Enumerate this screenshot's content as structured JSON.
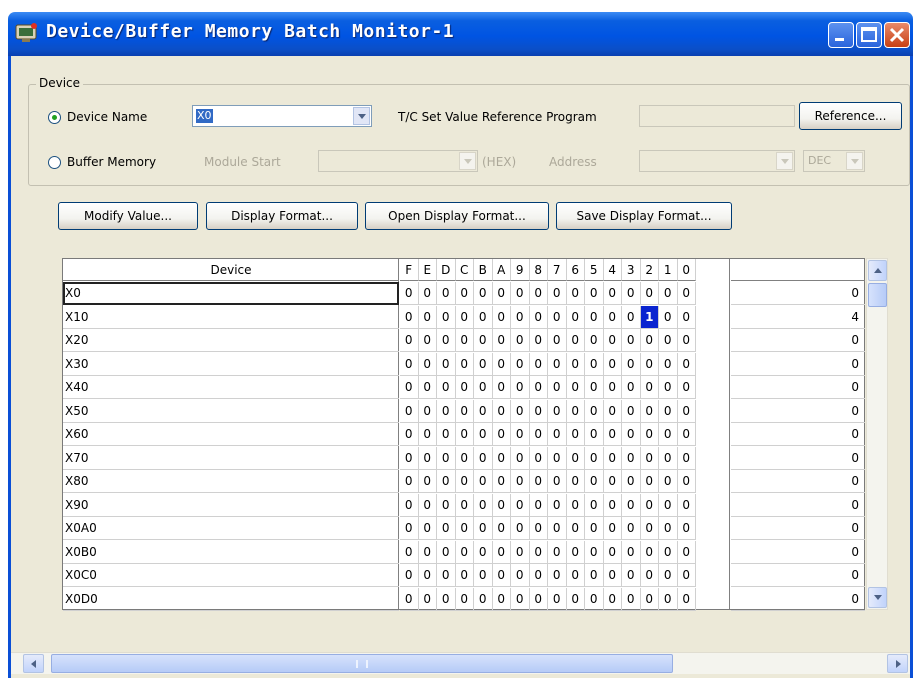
{
  "window": {
    "title": "Device/Buffer Memory Batch Monitor-1"
  },
  "device_group": {
    "legend": "Device",
    "device_name_label": "Device Name",
    "device_name_value": "X0",
    "tc_label": "T/C Set Value Reference Program",
    "tc_value": "",
    "reference_label": "Reference...",
    "buffer_memory_label": "Buffer Memory",
    "module_start_label": "Module Start",
    "module_start_value": "",
    "hex_label": "(HEX)",
    "address_label": "Address",
    "address_value": "",
    "format_value": "DEC",
    "selected_mode": "Device Name"
  },
  "toolbar": {
    "modify_value_label": "Modify Value...",
    "display_format_label": "Display Format...",
    "open_display_format_label": "Open Display Format...",
    "save_display_format_label": "Save Display Format..."
  },
  "grid": {
    "device_header": "Device",
    "bit_headers": [
      "F",
      "E",
      "D",
      "C",
      "B",
      "A",
      "9",
      "8",
      "7",
      "6",
      "5",
      "4",
      "3",
      "2",
      "1",
      "0"
    ],
    "value_header": "",
    "rows": [
      {
        "device": "X0",
        "bits": [
          "0",
          "0",
          "0",
          "0",
          "0",
          "0",
          "0",
          "0",
          "0",
          "0",
          "0",
          "0",
          "0",
          "0",
          "0",
          "0"
        ],
        "value": "0"
      },
      {
        "device": "X10",
        "bits": [
          "0",
          "0",
          "0",
          "0",
          "0",
          "0",
          "0",
          "0",
          "0",
          "0",
          "0",
          "0",
          "0",
          "1",
          "0",
          "0"
        ],
        "value": "4"
      },
      {
        "device": "X20",
        "bits": [
          "0",
          "0",
          "0",
          "0",
          "0",
          "0",
          "0",
          "0",
          "0",
          "0",
          "0",
          "0",
          "0",
          "0",
          "0",
          "0"
        ],
        "value": "0"
      },
      {
        "device": "X30",
        "bits": [
          "0",
          "0",
          "0",
          "0",
          "0",
          "0",
          "0",
          "0",
          "0",
          "0",
          "0",
          "0",
          "0",
          "0",
          "0",
          "0"
        ],
        "value": "0"
      },
      {
        "device": "X40",
        "bits": [
          "0",
          "0",
          "0",
          "0",
          "0",
          "0",
          "0",
          "0",
          "0",
          "0",
          "0",
          "0",
          "0",
          "0",
          "0",
          "0"
        ],
        "value": "0"
      },
      {
        "device": "X50",
        "bits": [
          "0",
          "0",
          "0",
          "0",
          "0",
          "0",
          "0",
          "0",
          "0",
          "0",
          "0",
          "0",
          "0",
          "0",
          "0",
          "0"
        ],
        "value": "0"
      },
      {
        "device": "X60",
        "bits": [
          "0",
          "0",
          "0",
          "0",
          "0",
          "0",
          "0",
          "0",
          "0",
          "0",
          "0",
          "0",
          "0",
          "0",
          "0",
          "0"
        ],
        "value": "0"
      },
      {
        "device": "X70",
        "bits": [
          "0",
          "0",
          "0",
          "0",
          "0",
          "0",
          "0",
          "0",
          "0",
          "0",
          "0",
          "0",
          "0",
          "0",
          "0",
          "0"
        ],
        "value": "0"
      },
      {
        "device": "X80",
        "bits": [
          "0",
          "0",
          "0",
          "0",
          "0",
          "0",
          "0",
          "0",
          "0",
          "0",
          "0",
          "0",
          "0",
          "0",
          "0",
          "0"
        ],
        "value": "0"
      },
      {
        "device": "X90",
        "bits": [
          "0",
          "0",
          "0",
          "0",
          "0",
          "0",
          "0",
          "0",
          "0",
          "0",
          "0",
          "0",
          "0",
          "0",
          "0",
          "0"
        ],
        "value": "0"
      },
      {
        "device": "X0A0",
        "bits": [
          "0",
          "0",
          "0",
          "0",
          "0",
          "0",
          "0",
          "0",
          "0",
          "0",
          "0",
          "0",
          "0",
          "0",
          "0",
          "0"
        ],
        "value": "0"
      },
      {
        "device": "X0B0",
        "bits": [
          "0",
          "0",
          "0",
          "0",
          "0",
          "0",
          "0",
          "0",
          "0",
          "0",
          "0",
          "0",
          "0",
          "0",
          "0",
          "0"
        ],
        "value": "0"
      },
      {
        "device": "X0C0",
        "bits": [
          "0",
          "0",
          "0",
          "0",
          "0",
          "0",
          "0",
          "0",
          "0",
          "0",
          "0",
          "0",
          "0",
          "0",
          "0",
          "0"
        ],
        "value": "0"
      },
      {
        "device": "X0D0",
        "bits": [
          "0",
          "0",
          "0",
          "0",
          "0",
          "0",
          "0",
          "0",
          "0",
          "0",
          "0",
          "0",
          "0",
          "0",
          "0",
          "0"
        ],
        "value": "0"
      }
    ]
  },
  "colors": {
    "titlebar": "#0054e3",
    "window_bg": "#ece9d8",
    "bit_highlight": "#0a24d0",
    "close_button": "#c83f13"
  }
}
